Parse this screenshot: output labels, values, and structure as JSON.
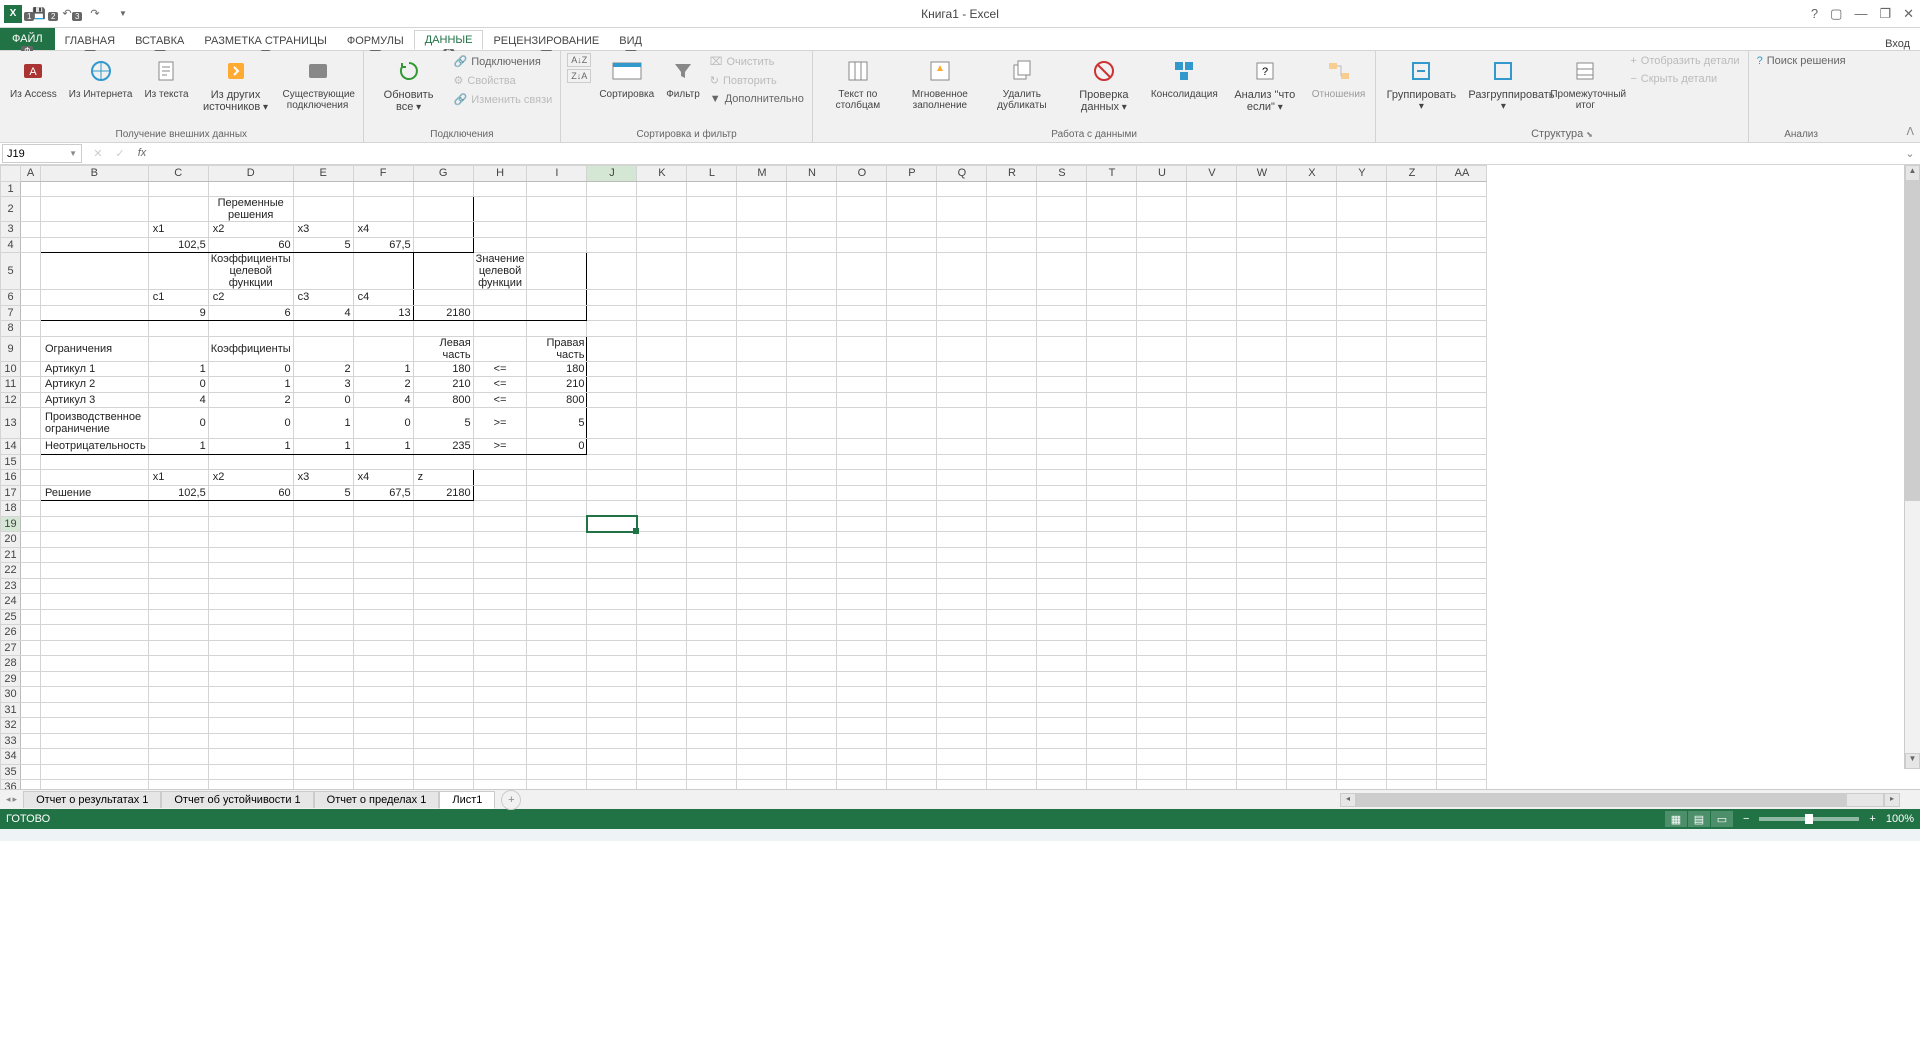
{
  "app": {
    "title": "Книга1 - Excel",
    "login": "Вход"
  },
  "qat": {
    "keys": [
      "1",
      "2",
      "3"
    ]
  },
  "tabs": {
    "file": "ФАЙЛ",
    "items": [
      {
        "label": "ГЛАВНАЯ",
        "key": "Я"
      },
      {
        "label": "ВСТАВКА",
        "key": "С"
      },
      {
        "label": "РАЗМЕТКА СТРАНИЦЫ",
        "key": "З"
      },
      {
        "label": "ФОРМУЛЫ",
        "key": "Л"
      },
      {
        "label": "ДАННЫЕ",
        "key": "Ё",
        "active": true
      },
      {
        "label": "РЕЦЕНЗИРОВАНИЕ",
        "key": "Р"
      },
      {
        "label": "ВИД",
        "key": "О"
      }
    ],
    "file_key": "Ф"
  },
  "ribbon": {
    "groups": [
      {
        "label": "Получение внешних данных"
      },
      {
        "label": "Подключения"
      },
      {
        "label": "Сортировка и фильтр"
      },
      {
        "label": "Работа с данными"
      },
      {
        "label": "Структура"
      },
      {
        "label": "Анализ"
      }
    ],
    "btns": {
      "access": "Из Access",
      "web": "Из Интернета",
      "text": "Из текста",
      "other": "Из других источников",
      "existing": "Существующие подключения",
      "refresh": "Обновить все",
      "connections": "Подключения",
      "properties": "Свойства",
      "editlinks": "Изменить связи",
      "sortaz": "AZ",
      "sort": "Сортировка",
      "filter": "Фильтр",
      "clear": "Очистить",
      "reapply": "Повторить",
      "advanced": "Дополнительно",
      "t2c": "Текст по столбцам",
      "flash": "Мгновенное заполнение",
      "dedup": "Удалить дубликаты",
      "valid": "Проверка данных",
      "consol": "Консолидация",
      "whatif": "Анализ \"что если\"",
      "relations": "Отношения",
      "group": "Группировать",
      "ungroup": "Разгруппировать",
      "subtotal": "Промежуточный итог",
      "showdetail": "Отобразить детали",
      "hidedetail": "Скрыть детали",
      "solver": "Поиск решения"
    }
  },
  "namebox": "J19",
  "columns": [
    "A",
    "B",
    "C",
    "D",
    "E",
    "F",
    "G",
    "H",
    "I",
    "J",
    "K",
    "L",
    "M",
    "N",
    "O",
    "P",
    "Q",
    "R",
    "S",
    "T",
    "U",
    "V",
    "W",
    "X",
    "Y",
    "Z",
    "AA"
  ],
  "sheet": {
    "r2": {
      "title": "Переменные решения"
    },
    "r3": {
      "c": "x1",
      "d": "x2",
      "e": "x3",
      "f": "x4"
    },
    "r4": {
      "c": "102,5",
      "d": "60",
      "e": "5",
      "f": "67,5"
    },
    "r5": {
      "t1": "Коэффициенты целевой функции",
      "t2": "Значение целевой функции"
    },
    "r6": {
      "c": "c1",
      "d": "c2",
      "e": "c3",
      "f": "c4"
    },
    "r7": {
      "c": "9",
      "d": "6",
      "e": "4",
      "f": "13",
      "g": "2180"
    },
    "r9": {
      "b": "Ограничения",
      "coef": "Коэффициенты",
      "g": "Левая часть",
      "i": "Правая часть"
    },
    "r10": {
      "b": "Артикул 1",
      "c": "1",
      "d": "0",
      "e": "2",
      "f": "1",
      "g": "180",
      "h": "<=",
      "i": "180"
    },
    "r11": {
      "b": "Артикул 2",
      "c": "0",
      "d": "1",
      "e": "3",
      "f": "2",
      "g": "210",
      "h": "<=",
      "i": "210"
    },
    "r12": {
      "b": "Артикул 3",
      "c": "4",
      "d": "2",
      "e": "0",
      "f": "4",
      "g": "800",
      "h": "<=",
      "i": "800"
    },
    "r13": {
      "b": "Производственное ограничение",
      "c": "0",
      "d": "0",
      "e": "1",
      "f": "0",
      "g": "5",
      "h": ">=",
      "i": "5"
    },
    "r14": {
      "b": "Неотрицательность",
      "c": "1",
      "d": "1",
      "e": "1",
      "f": "1",
      "g": "235",
      "h": ">=",
      "i": "0"
    },
    "r16": {
      "c": "x1",
      "d": "x2",
      "e": "x3",
      "f": "x4",
      "g": "z"
    },
    "r17": {
      "b": "Решение",
      "c": "102,5",
      "d": "60",
      "e": "5",
      "f": "67,5",
      "g": "2180"
    }
  },
  "sheets": {
    "tabs": [
      "Отчет о результатах 1",
      "Отчет об устойчивости 1",
      "Отчет о пределах 1",
      "Лист1"
    ],
    "active": 3
  },
  "statusbar": {
    "ready": "ГОТОВО",
    "zoom": "100%"
  }
}
